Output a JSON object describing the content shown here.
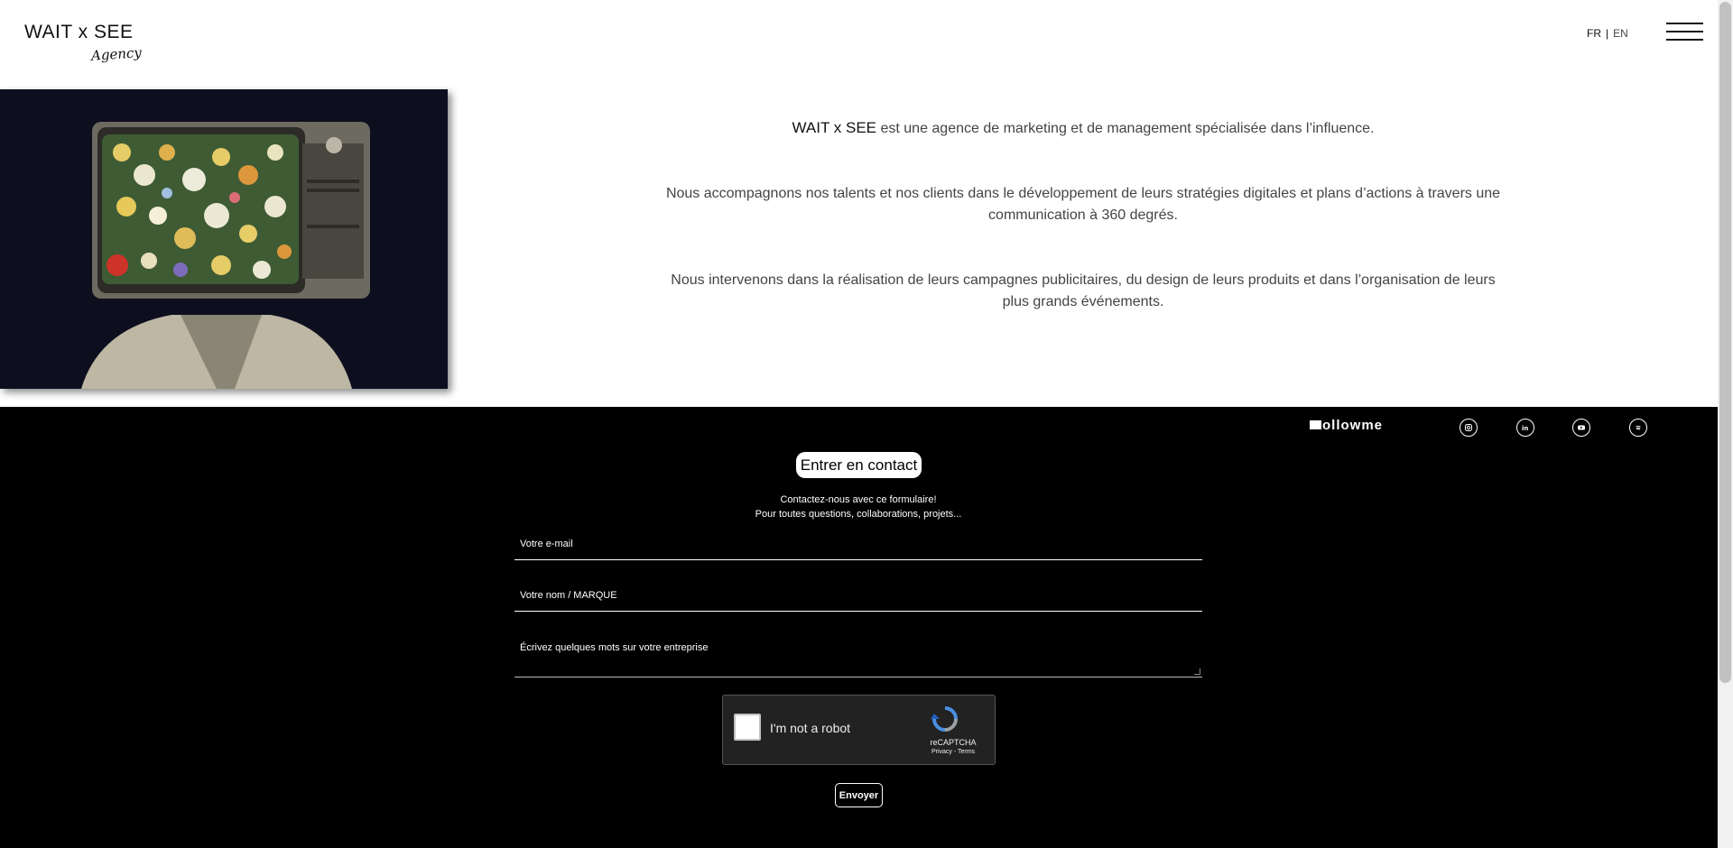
{
  "header": {
    "logo_main": "WAIT x SEE",
    "logo_sub": "Agency",
    "lang_fr": "FR",
    "lang_sep": "|",
    "lang_en": "EN",
    "menu_icon": "hamburger-icon"
  },
  "intro": {
    "p1_brand": "WAIT x SEE",
    "p1_rest": " est une agence de marketing et de management spécialisée dans l’influence.",
    "p2": "Nous accompagnons nos talents et nos clients dans le développement de leurs stratégies digitales et plans d’actions à travers une communication à 360 degrés.",
    "p3": "Nous intervenons dans la réalisation de leurs campagnes publicitaires, du design de leurs produits et dans l’organisation de leurs plus grands événements."
  },
  "follow": {
    "label": "ollowme",
    "socials": [
      "instagram-icon",
      "linkedin-icon",
      "youtube-icon",
      "spotify-icon"
    ]
  },
  "contact": {
    "button": "Entrer en contact",
    "line1": "Contactez-nous avec ce formulaire!",
    "line2": "Pour toutes questions, collaborations, projets...",
    "email_placeholder": "Votre e-mail",
    "name_placeholder": "Votre nom / MARQUE",
    "message_placeholder": "Écrivez quelques mots sur votre entreprise",
    "captcha_label": "I'm not a robot",
    "captcha_brand": "reCAPTCHA",
    "captcha_terms": "Privacy - Terms",
    "send": "Envoyer"
  },
  "colors": {
    "dark_bg": "#000000",
    "text": "#444444"
  }
}
